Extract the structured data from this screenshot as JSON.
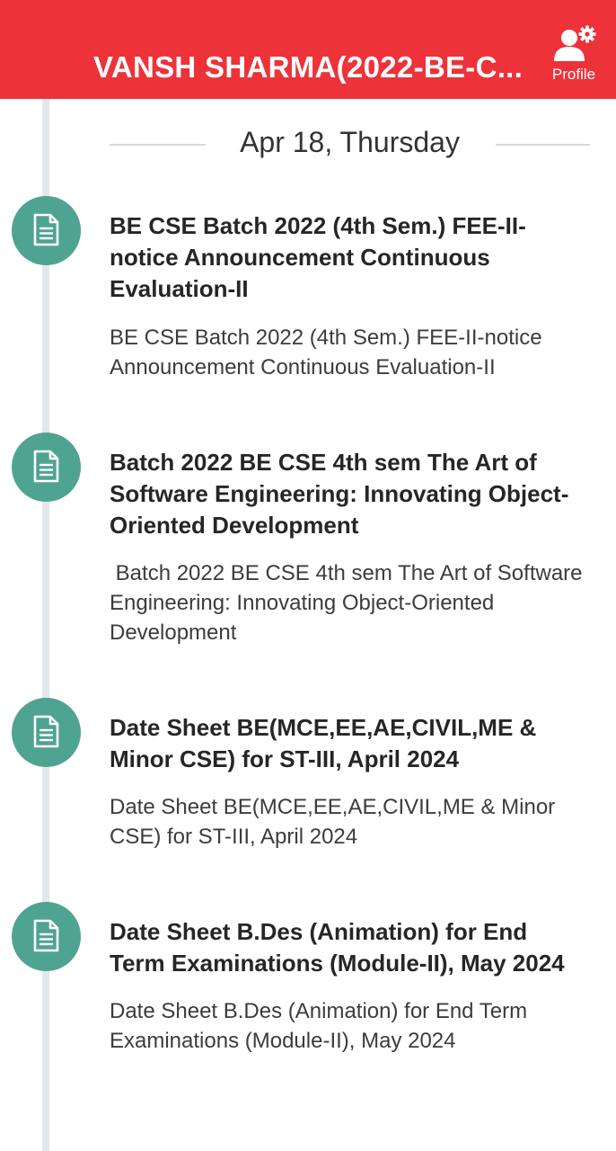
{
  "header": {
    "title": "VANSH SHARMA(2022-BE-C...",
    "profile_label": "Profile",
    "profile_icon": "user-gear-icon",
    "background_color": "#ee3239"
  },
  "timeline": {
    "date_label": "Apr 18, Thursday",
    "entry_icon": "document-icon",
    "icon_color": "#4fa491",
    "entries": [
      {
        "title": "BE CSE Batch 2022 (4th Sem.) FEE-II-notice Announcement Continuous Evaluation-II",
        "description": "BE CSE Batch 2022 (4th Sem.) FEE-II-notice Announcement Continuous Evaluation-II"
      },
      {
        "title": "Batch 2022 BE CSE 4th sem The Art of Software Engineering: Innovating Object-Oriented Development",
        "description": " Batch 2022 BE CSE 4th sem The Art of Software Engineering: Innovating Object-Oriented Development"
      },
      {
        "title": "Date Sheet BE(MCE,EE,AE,CIVIL,ME & Minor CSE) for ST-III, April 2024",
        "description": "Date Sheet BE(MCE,EE,AE,CIVIL,ME & Minor CSE) for ST-III, April 2024"
      },
      {
        "title": "Date Sheet B.Des (Animation) for End Term Examinations (Module-II), May 2024",
        "description": "Date Sheet B.Des (Animation) for End Term Examinations (Module-II), May 2024"
      }
    ]
  }
}
